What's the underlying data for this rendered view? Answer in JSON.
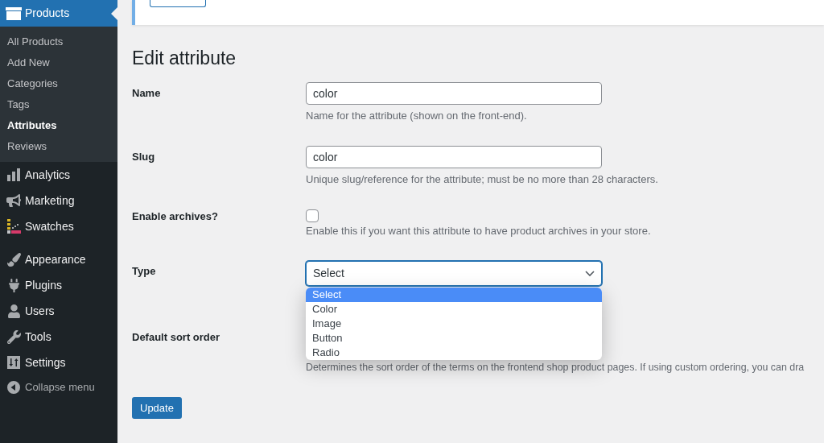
{
  "sidebar": {
    "menu": [
      {
        "kind": "item",
        "label": "Products",
        "selected": true,
        "submenu": [
          {
            "label": "All Products",
            "selected": false
          },
          {
            "label": "Add New",
            "selected": false
          },
          {
            "label": "Categories",
            "selected": false
          },
          {
            "label": "Tags",
            "selected": false
          },
          {
            "label": "Attributes",
            "selected": true
          },
          {
            "label": "Reviews",
            "selected": false
          }
        ]
      },
      {
        "kind": "item",
        "label": "Analytics",
        "selected": false
      },
      {
        "kind": "item",
        "label": "Marketing",
        "selected": false
      },
      {
        "kind": "item",
        "label": "Swatches",
        "selected": false
      },
      {
        "kind": "separator"
      },
      {
        "kind": "item",
        "label": "Appearance",
        "selected": false
      },
      {
        "kind": "item",
        "label": "Plugins",
        "selected": false
      },
      {
        "kind": "item",
        "label": "Users",
        "selected": false
      },
      {
        "kind": "item",
        "label": "Tools",
        "selected": false
      },
      {
        "kind": "item",
        "label": "Settings",
        "selected": false
      }
    ],
    "collapse": {
      "label": "Collapse menu"
    }
  },
  "page": {
    "title": "Edit attribute"
  },
  "form": {
    "fields": [
      {
        "kind": "text",
        "label": "Name",
        "value": "color",
        "description": "Name for the attribute (shown on the front-end)."
      },
      {
        "kind": "text",
        "label": "Slug",
        "value": "color",
        "description": "Unique slug/reference for the attribute; must be no more than 28 characters."
      },
      {
        "kind": "checkbox",
        "label": "Enable archives?",
        "checked": false,
        "description": "Enable this if you want this attribute to have product archives in your store."
      },
      {
        "kind": "select",
        "label": "Type",
        "value": "Select",
        "expanded": true,
        "options": [
          {
            "label": "Select",
            "selected": true
          },
          {
            "label": "Color",
            "selected": false
          },
          {
            "label": "Image",
            "selected": false
          },
          {
            "label": "Button",
            "selected": false
          },
          {
            "label": "Radio",
            "selected": false
          }
        ]
      },
      {
        "kind": "covered_select",
        "label": "Default sort order",
        "description": "Determines the sort order of the terms on the frontend shop product pages. If using custom ordering, you can dra"
      }
    ],
    "submit": "Update"
  }
}
